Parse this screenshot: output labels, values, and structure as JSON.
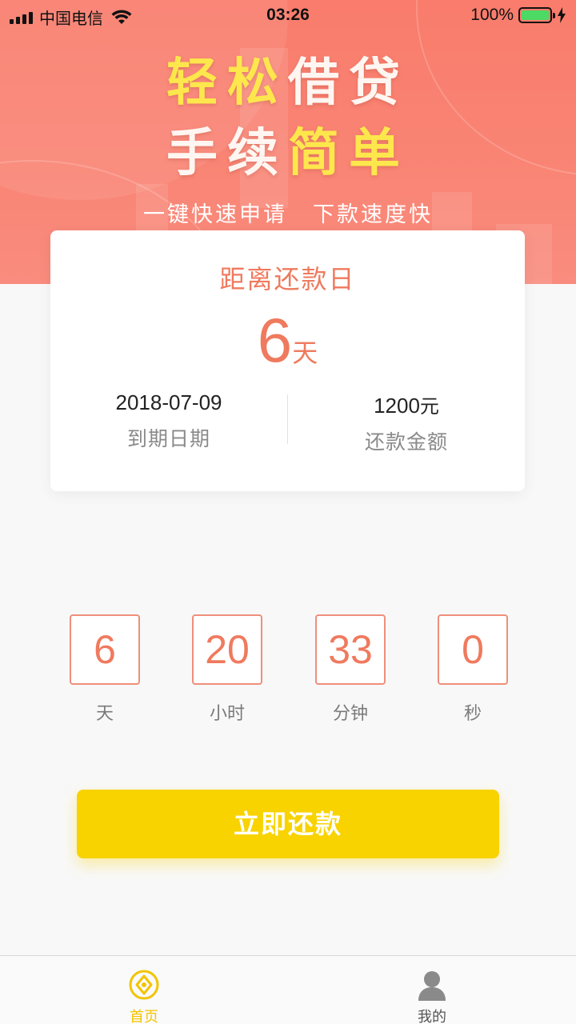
{
  "status_bar": {
    "carrier": "中国电信",
    "time": "03:26",
    "battery": "100%"
  },
  "banner": {
    "line1": [
      {
        "text": "轻松",
        "color": "yellow"
      },
      {
        "text": "借贷",
        "color": "white"
      }
    ],
    "line2": [
      {
        "text": "手续",
        "color": "white"
      },
      {
        "text": "简单",
        "color": "yellow"
      }
    ],
    "tagline_left": "一键快速申请",
    "tagline_right": "下款速度快"
  },
  "card": {
    "title": "距离还款日",
    "days_value": "6",
    "days_unit": "天",
    "due_date": "2018-07-09",
    "due_date_label": "到期日期",
    "amount_value": "1200",
    "amount_unit": "元",
    "amount_label": "还款金额"
  },
  "countdown": {
    "days": "6",
    "days_label": "天",
    "hours": "20",
    "hours_label": "小时",
    "minutes": "33",
    "minutes_label": "分钟",
    "seconds": "0",
    "seconds_label": "秒"
  },
  "actions": {
    "pay_label": "立即还款"
  },
  "tab_bar": {
    "home_label": "首页",
    "mine_label": "我的"
  },
  "colors": {
    "accent": "#ef7a5e",
    "button": "#f8d300",
    "banner": "#f97c6c",
    "tab_active": "#f3c400"
  }
}
